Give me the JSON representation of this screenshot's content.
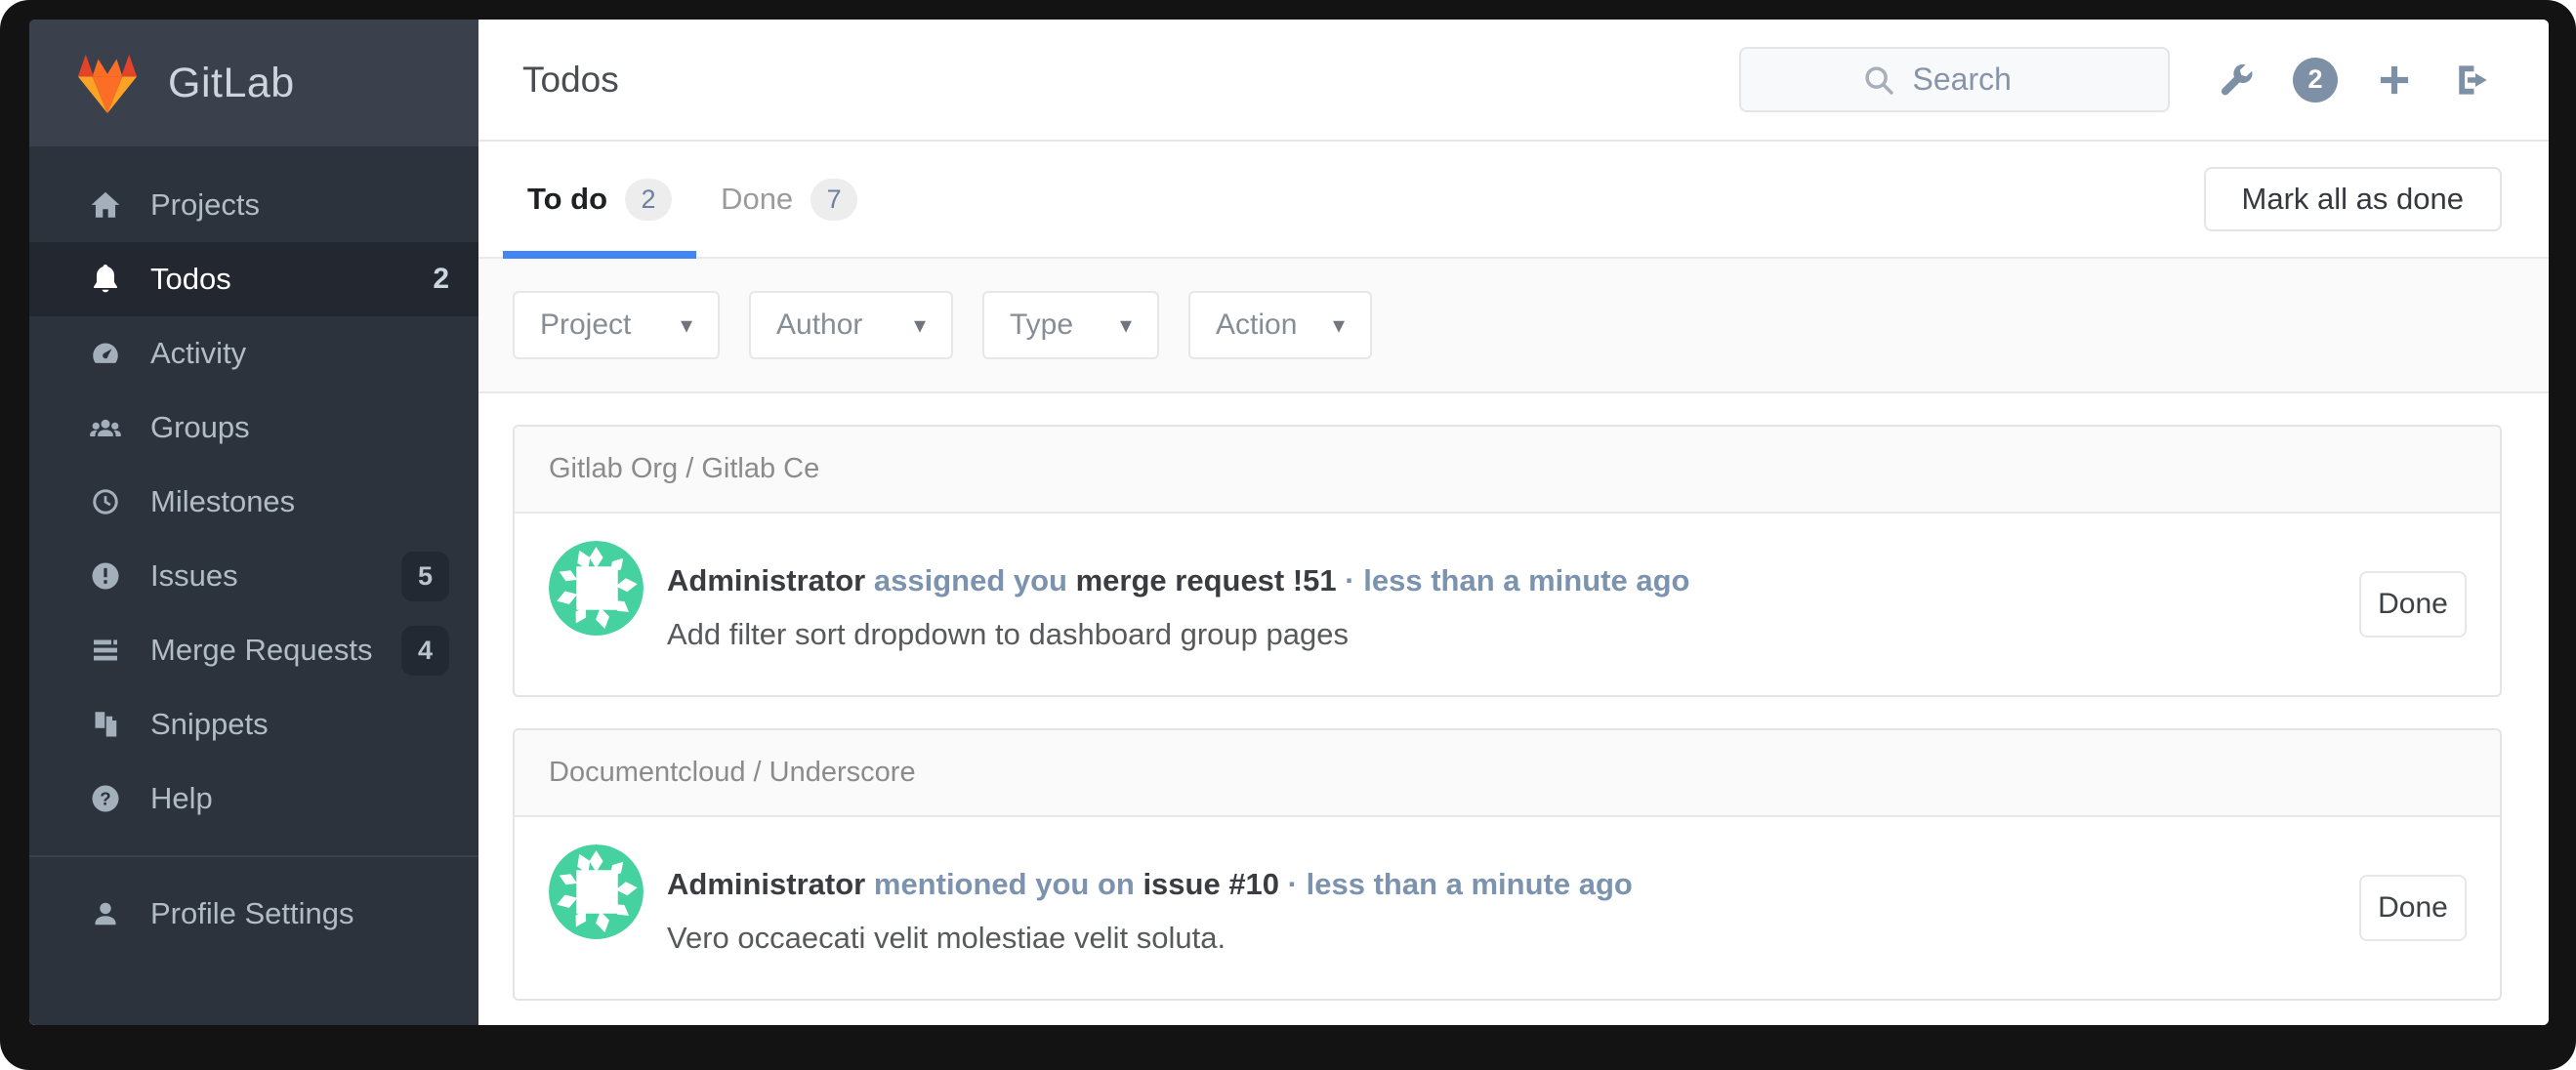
{
  "sidebar": {
    "logo_text": "GitLab",
    "items": [
      {
        "label": "Projects",
        "icon": "home-icon",
        "badge": null,
        "active": false
      },
      {
        "label": "Todos",
        "icon": "bell-icon",
        "badge": "2",
        "active": true
      },
      {
        "label": "Activity",
        "icon": "gauge-icon",
        "badge": null,
        "active": false
      },
      {
        "label": "Groups",
        "icon": "users-icon",
        "badge": null,
        "active": false
      },
      {
        "label": "Milestones",
        "icon": "clock-icon",
        "badge": null,
        "active": false
      },
      {
        "label": "Issues",
        "icon": "issue-circle-icon",
        "badge": "5",
        "active": false
      },
      {
        "label": "Merge Requests",
        "icon": "list-bars-icon",
        "badge": "4",
        "active": false
      },
      {
        "label": "Snippets",
        "icon": "file-copy-icon",
        "badge": null,
        "active": false
      },
      {
        "label": "Help",
        "icon": "question-circle-icon",
        "badge": null,
        "active": false
      }
    ],
    "profile": {
      "label": "Profile Settings",
      "icon": "user-icon"
    }
  },
  "header": {
    "title": "Todos",
    "search_placeholder": "Search",
    "todo_count": "2",
    "icons": [
      "wrench-icon",
      "todo-count-badge",
      "plus-icon",
      "sign-out-icon"
    ]
  },
  "tabs": [
    {
      "label": "To do",
      "count": "2",
      "active": true
    },
    {
      "label": "Done",
      "count": "7",
      "active": false
    }
  ],
  "mark_all_label": "Mark all as done",
  "filters": [
    {
      "label": "Project"
    },
    {
      "label": "Author"
    },
    {
      "label": "Type"
    },
    {
      "label": "Action"
    }
  ],
  "icons": {
    "caret": "▾"
  },
  "groups": [
    {
      "project": "Gitlab Org / Gitlab Ce",
      "todos": [
        {
          "author": "Administrator",
          "action": "assigned you",
          "target": "merge request !51",
          "separator": "·",
          "time": "less than a minute ago",
          "body": "Add filter sort dropdown to dashboard group pages",
          "button_label": "Done"
        }
      ]
    },
    {
      "project": "Documentcloud / Underscore",
      "todos": [
        {
          "author": "Administrator",
          "action": "mentioned you on",
          "target": "issue #10",
          "separator": "·",
          "time": "less than a minute ago",
          "body": "Vero occaecati velit molestiae velit soluta.",
          "button_label": "Done"
        }
      ]
    }
  ],
  "colors": {
    "brand_red": "#e24329",
    "brand_orange": "#fc6d26",
    "brand_yellow": "#fca326",
    "accent_blue": "#4285f4",
    "avatar_teal": "#46d2a0",
    "sidebar_bg": "#2d333d",
    "sidebar_header_bg": "#3a414c",
    "sidebar_active_bg": "#232830",
    "slate_link": "#7b93ae"
  }
}
